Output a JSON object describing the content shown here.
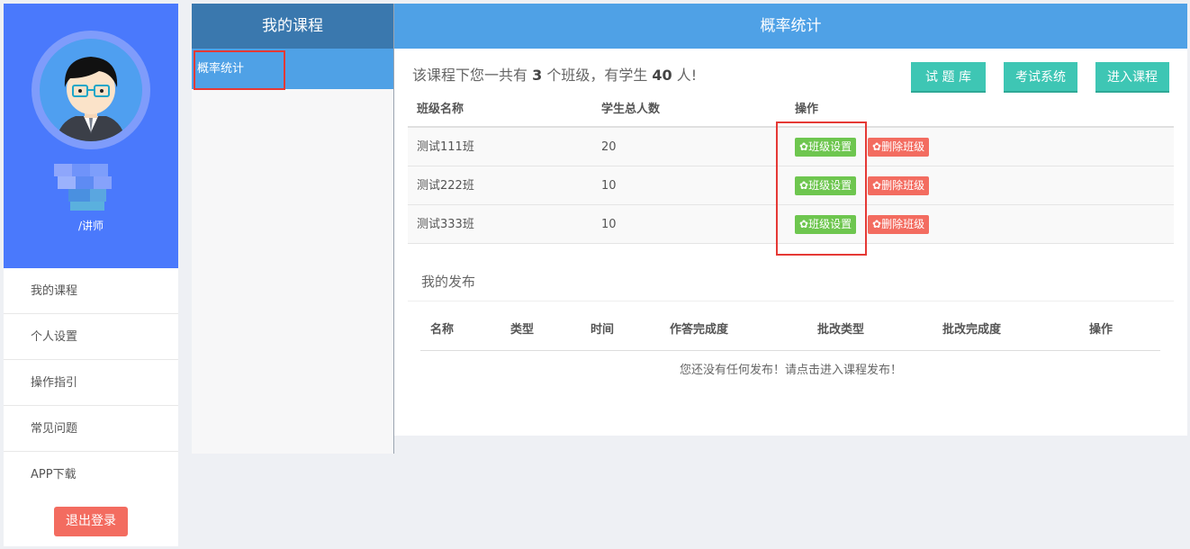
{
  "sidebar": {
    "role": "/讲师",
    "menu": [
      "我的课程",
      "个人设置",
      "操作指引",
      "常见问题",
      "APP下载"
    ],
    "logout_label": "退出登录"
  },
  "course_panel": {
    "header": "我的课程",
    "items": [
      "概率统计"
    ]
  },
  "main": {
    "header": "概率统计",
    "summary": {
      "prefix": "该课程下您一共有 ",
      "class_count": "3",
      "middle": " 个班级，有学生 ",
      "student_count": "40",
      "suffix": " 人!"
    },
    "buttons": {
      "question_bank": "试 题 库",
      "exam_system": "考试系统",
      "enter_course": "进入课程"
    },
    "class_table": {
      "headers": [
        "班级名称",
        "学生总人数",
        "操作"
      ],
      "rows": [
        {
          "name": "测试111班",
          "count": "20"
        },
        {
          "name": "测试222班",
          "count": "10"
        },
        {
          "name": "测试333班",
          "count": "10"
        }
      ],
      "settings_label": "班级设置",
      "delete_label": "删除班级"
    },
    "publish": {
      "title": "我的发布",
      "headers": [
        "名称",
        "类型",
        "时间",
        "作答完成度",
        "批改类型",
        "批改完成度",
        "操作"
      ],
      "empty": "您还没有任何发布！请点击进入课程发布！"
    }
  },
  "colors": {
    "brand_blue": "#4a79fc",
    "header_blue": "#4fa1e6",
    "dark_blue": "#3a78ae",
    "teal": "#3ec6b4",
    "green": "#6ec64f",
    "red": "#f36c60"
  }
}
